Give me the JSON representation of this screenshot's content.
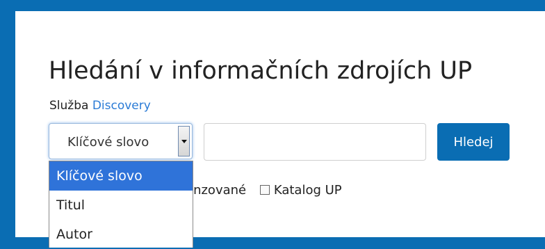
{
  "page": {
    "title": "Hledání v informačních zdrojích UP"
  },
  "service": {
    "prefix": "Služba",
    "link": "Discovery"
  },
  "search": {
    "selected": "Klíčové slovo",
    "query_value": "",
    "button_label": "Hledej",
    "options": [
      "Klíčové slovo",
      "Titul",
      "Autor"
    ]
  },
  "filters": [
    {
      "label": "Recenzované",
      "visible_text": "enzované",
      "checked": false
    },
    {
      "label": "Katalog UP",
      "checked": false
    }
  ],
  "colors": {
    "brand": "#0a6db3",
    "link": "#2a7bd6",
    "highlight": "#2f73d9"
  }
}
